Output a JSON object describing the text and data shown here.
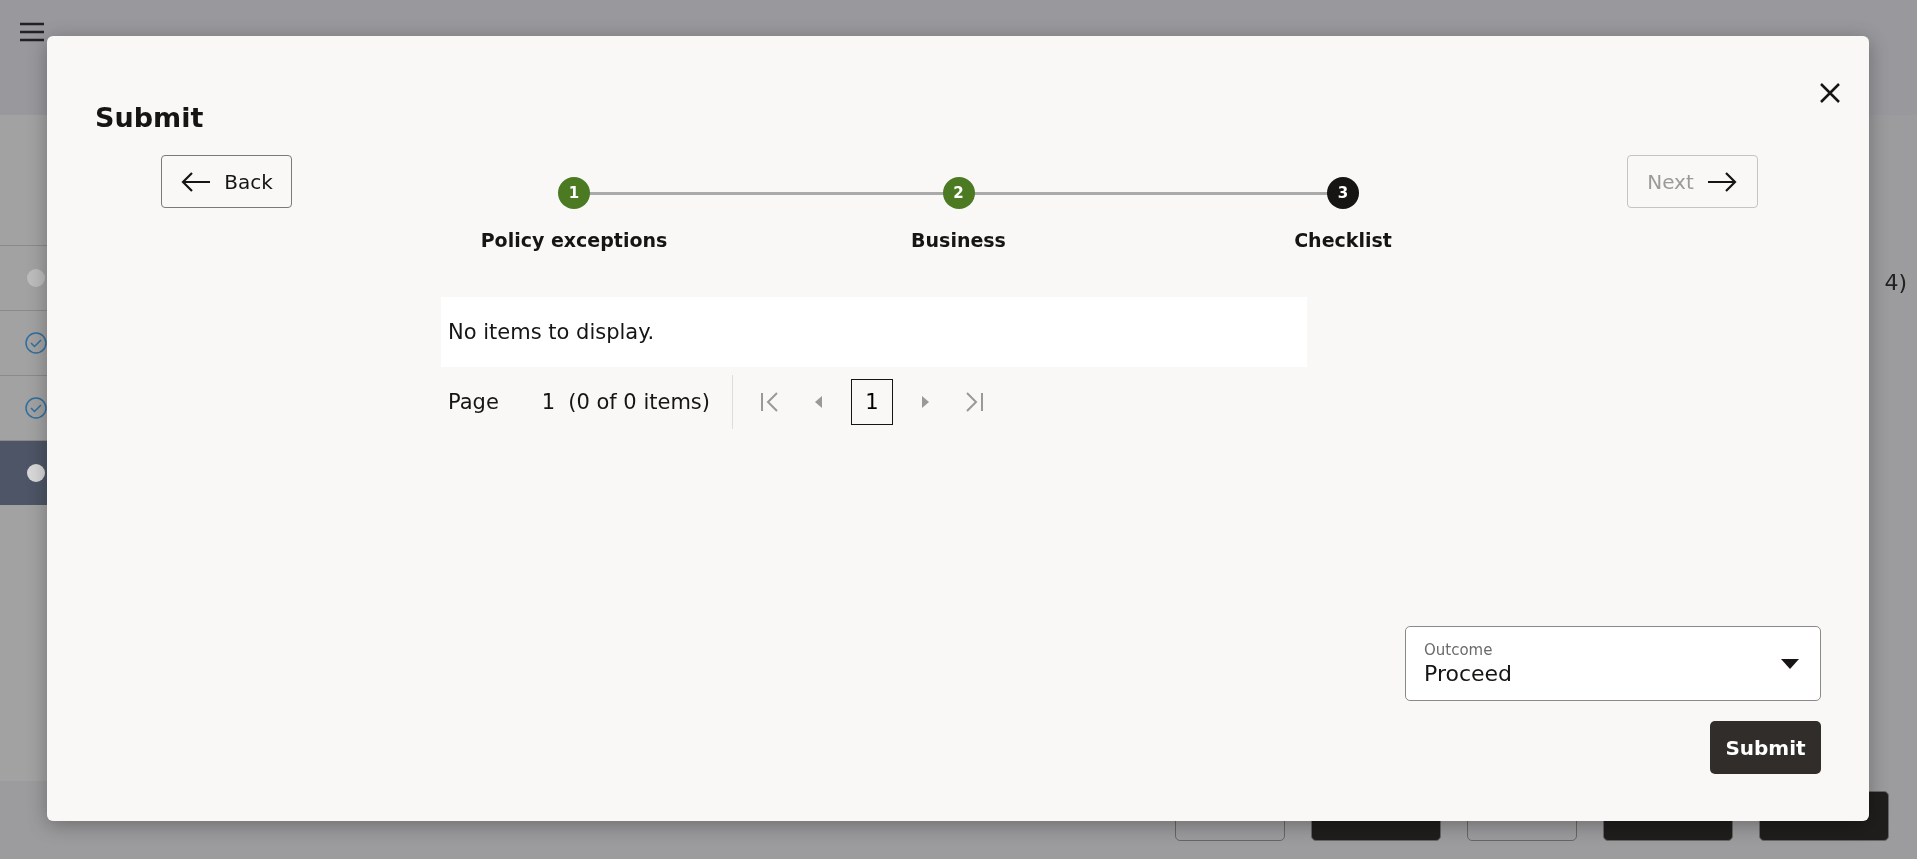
{
  "background": {
    "rail": [
      {
        "kind": "pending",
        "selected": false
      },
      {
        "kind": "done",
        "selected": false
      },
      {
        "kind": "done",
        "selected": false
      },
      {
        "kind": "current",
        "selected": true
      }
    ],
    "side_count": "4)",
    "footer_buttons": [
      {
        "kind": "outline"
      },
      {
        "kind": "solid"
      },
      {
        "kind": "outline"
      },
      {
        "kind": "solid"
      },
      {
        "kind": "solid"
      }
    ]
  },
  "dialog": {
    "title": "Submit",
    "back_button": {
      "label": "Back"
    },
    "next_button": {
      "label": "Next",
      "disabled": true
    },
    "steps": [
      {
        "number": "1",
        "label": "Policy exceptions",
        "completed": true
      },
      {
        "number": "2",
        "label": "Business",
        "completed": true
      },
      {
        "number": "3",
        "label": "Checklist",
        "completed": false
      }
    ],
    "table": {
      "empty_message": "No items to display."
    },
    "pagination": {
      "page_label": "Page",
      "page": "1",
      "summary": "(0 of 0 items)",
      "current_page": "1"
    },
    "outcome": {
      "label": "Outcome",
      "value": "Proceed"
    },
    "submit_button": {
      "label": "Submit"
    }
  }
}
